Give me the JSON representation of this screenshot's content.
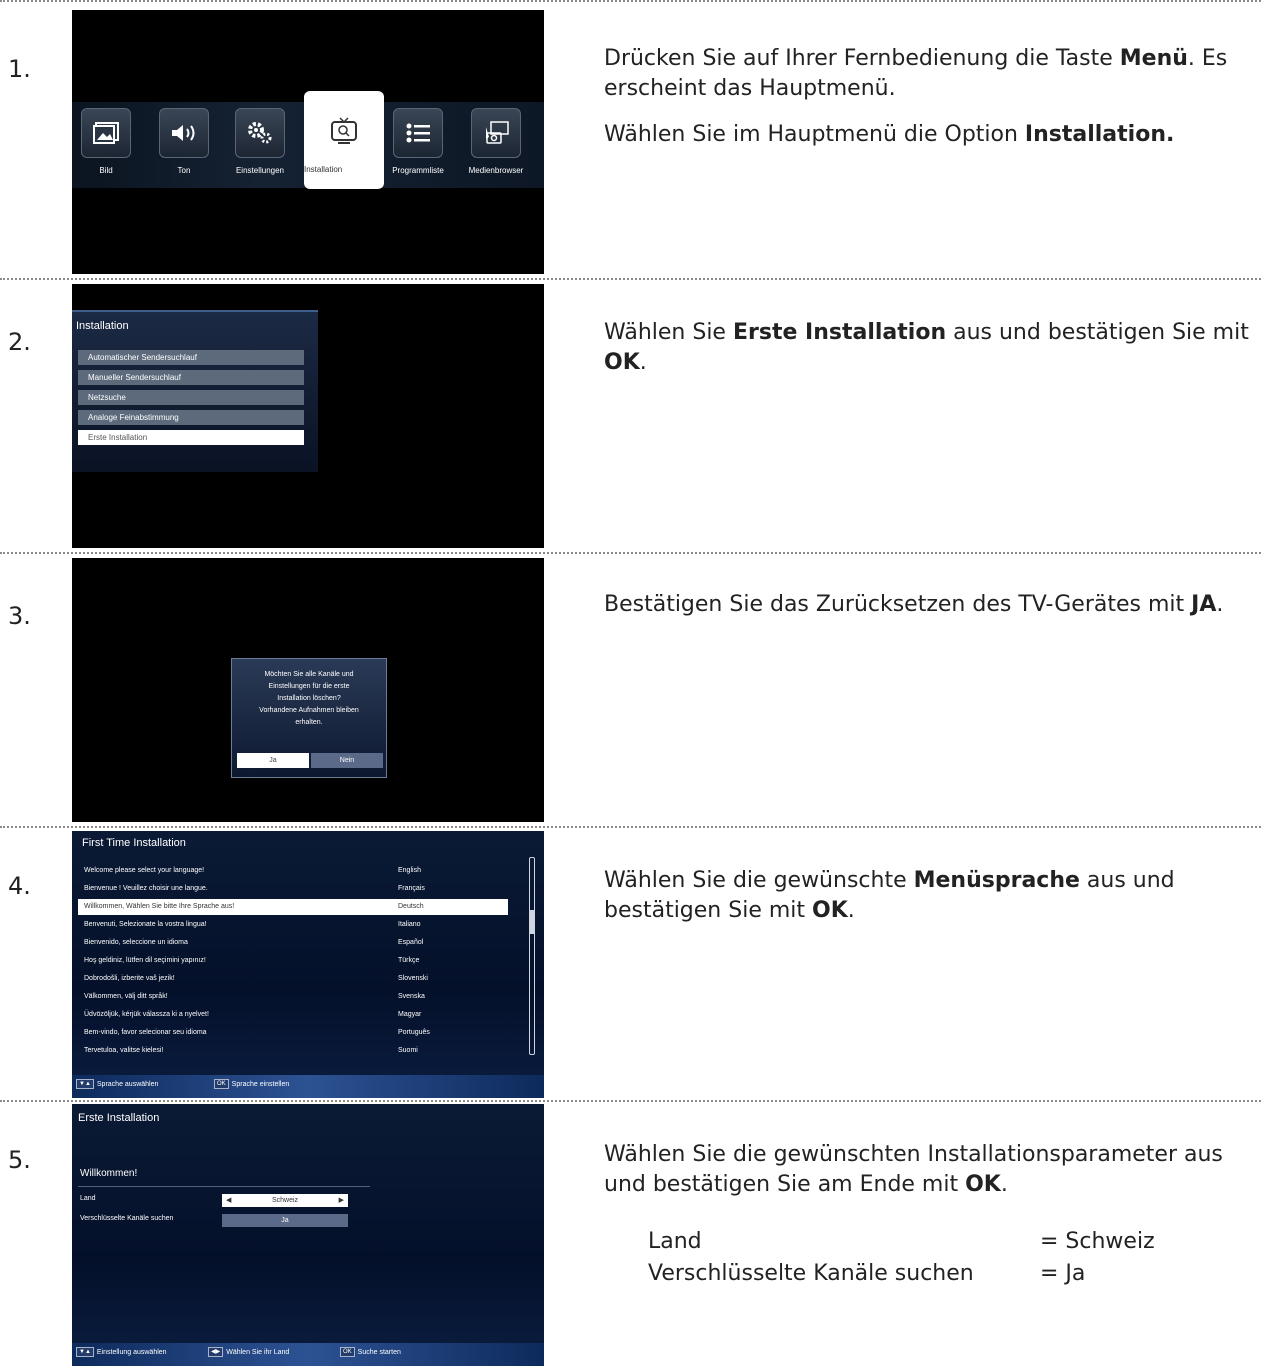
{
  "steps": [
    {
      "number": "1.",
      "screen": {
        "menu_items": [
          {
            "label": "Bild",
            "icon": "picture-icon"
          },
          {
            "label": "Ton",
            "icon": "speaker-icon"
          },
          {
            "label": "Einstellungen",
            "icon": "gears-icon"
          },
          {
            "label": "Installation",
            "icon": "tv-search-icon"
          },
          {
            "label": "Programmliste",
            "icon": "list-icon"
          },
          {
            "label": "Medienbrowser",
            "icon": "media-icon"
          }
        ],
        "selected": "Installation"
      },
      "desc": [
        {
          "pre": "Drücken Sie auf Ihrer Fernbedienung die Taste ",
          "bold": "Menü",
          "post": ". Es erscheint das Hauptmenü."
        },
        {
          "pre": "Wählen Sie im Hauptmenü die Option ",
          "bold": "Installation.",
          "post": ""
        }
      ]
    },
    {
      "number": "2.",
      "screen": {
        "title": "Installation",
        "options": [
          "Automatischer Sendersuchlauf",
          "Manueller Sendersuchlauf",
          "Netzsuche",
          "Analoge Feinabstimmung",
          "Erste Installation"
        ],
        "selected": "Erste Installation"
      },
      "desc": [
        {
          "pre": "Wählen Sie ",
          "bold": "Erste Installation",
          "mid": " aus und bestätigen Sie mit ",
          "bold2": "OK",
          "post": "."
        }
      ]
    },
    {
      "number": "3.",
      "screen": {
        "dialog_lines": [
          "Möchten Sie alle Kanäle und",
          "Einstellungen für die erste",
          "Installation löschen?",
          "Vorhandene Aufnahmen bleiben",
          "erhalten."
        ],
        "yes": "Ja",
        "no": "Nein"
      },
      "desc": [
        {
          "pre": "Bestätigen Sie das Zurücksetzen des TV-Gerätes mit ",
          "bold": "JA",
          "post": "."
        }
      ]
    },
    {
      "number": "4.",
      "screen": {
        "title": "First Time Installation",
        "rows": [
          {
            "msg": "Welcome please select your language!",
            "lang": "English"
          },
          {
            "msg": "Bienvenue ! Veuillez choisir une langue.",
            "lang": "Français"
          },
          {
            "msg": "Willkommen, Wählen Sie bitte Ihre Sprache aus!",
            "lang": "Deutsch"
          },
          {
            "msg": "Benvenuti, Selezionate la vostra lingua!",
            "lang": "Italiano"
          },
          {
            "msg": "Bienvenido, seleccione un idioma",
            "lang": "Español"
          },
          {
            "msg": "Hoş geldiniz, lütfen dil seçimini yapınız!",
            "lang": "Türkçe"
          },
          {
            "msg": "Dobrodošli, izberite vaš jezik!",
            "lang": "Slovenski"
          },
          {
            "msg": "Välkommen, välj ditt språk!",
            "lang": "Svenska"
          },
          {
            "msg": "Üdvözöljük, kérjük válassza ki a nyelvet!",
            "lang": "Magyar"
          },
          {
            "msg": "Bem-vindo, favor selecionar seu idioma",
            "lang": "Português"
          },
          {
            "msg": "Tervetuloa, valitse kielesi!",
            "lang": "Suomi"
          }
        ],
        "selected_row": 2,
        "footer": [
          {
            "key": "▼▲",
            "label": "Sprache auswählen"
          },
          {
            "key": "OK",
            "label": "Sprache einstellen"
          }
        ]
      },
      "desc": [
        {
          "pre": "Wählen Sie die gewünschte ",
          "bold": "Menüsprache",
          "mid": " aus und bestätigen Sie mit ",
          "bold2": "OK",
          "post": "."
        }
      ]
    },
    {
      "number": "5.",
      "screen": {
        "title": "Erste Installation",
        "welcome": "Willkommen!",
        "fields": [
          {
            "label": "Land",
            "value": "Schweiz"
          },
          {
            "label": "Verschlüsselte Kanäle suchen",
            "value": "Ja"
          }
        ],
        "footer": [
          {
            "key": "▼▲",
            "label": "Einstellung auswählen"
          },
          {
            "key": "◀▶",
            "label": "Wählen Sie ihr Land"
          },
          {
            "key": "OK",
            "label": "Suche starten"
          }
        ]
      },
      "desc": [
        {
          "pre": "Wählen Sie die gewünschten Installationsparameter aus und bestätigen Sie am Ende mit ",
          "bold": "OK",
          "post": "."
        }
      ],
      "params": [
        {
          "name": "Land",
          "value": "= Schweiz"
        },
        {
          "name": "Verschlüsselte Kanäle suchen",
          "value": "= Ja"
        }
      ]
    }
  ]
}
